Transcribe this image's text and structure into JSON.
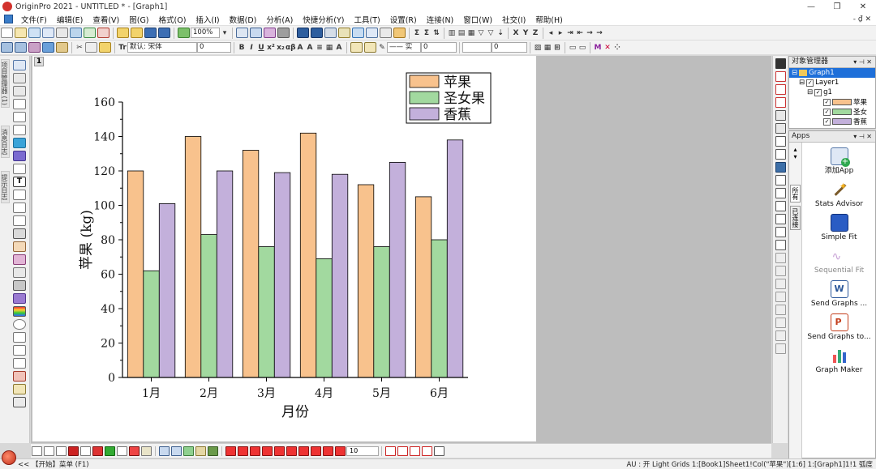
{
  "window": {
    "title": "OriginPro 2021 - UNTITLED * - [Graph1]",
    "controls": {
      "minimize": "—",
      "restore": "❐",
      "close": "✕"
    },
    "mdi_controls": "- ₫ ✕"
  },
  "menu": [
    "文件(F)",
    "编辑(E)",
    "查看(V)",
    "图(G)",
    "格式(O)",
    "插入(I)",
    "数据(D)",
    "分析(A)",
    "快捷分析(Y)",
    "工具(T)",
    "设置(R)",
    "连接(N)",
    "窗口(W)",
    "社交(I)",
    "帮助(H)"
  ],
  "toolbar": {
    "zoom": "100%",
    "font_name": "默认: 宋体",
    "font_size": "0",
    "bottom_size": "10",
    "line_width": "0"
  },
  "layer_number": "1",
  "left_tabs": [
    "项目管理器 (1)",
    "消息日志",
    "提示日志"
  ],
  "object_manager": {
    "title": "对象管理器",
    "graph": "Graph1",
    "layer": "Layer1",
    "group": "g1",
    "plots": [
      {
        "label": "苹果",
        "color": "#F8C28D"
      },
      {
        "label": "圣女",
        "color": "#A2D99F"
      },
      {
        "label": "香蕉",
        "color": "#C3B0DB"
      }
    ]
  },
  "apps_panel": {
    "title": "Apps",
    "nav_tabs": [
      "所有",
      "已连接"
    ],
    "items": [
      {
        "label": "添加App",
        "enabled": true
      },
      {
        "label": "Stats Advisor",
        "enabled": true
      },
      {
        "label": "Simple Fit",
        "enabled": true
      },
      {
        "label": "Sequential Fit",
        "enabled": false
      },
      {
        "label": "Send Graphs ...",
        "enabled": true
      },
      {
        "label": "Send Graphs to...",
        "enabled": true
      },
      {
        "label": "Graph Maker",
        "enabled": true
      }
    ]
  },
  "statusbar": {
    "left": "<< 【开始】菜单 (F1)",
    "right": "AU : 开  Light Grids  1:[Book1]Sheet1!Col(\"苹果\")[1:6]  1:[Graph1]1!1  弧度"
  },
  "chart_data": {
    "type": "bar",
    "categories": [
      "1月",
      "2月",
      "3月",
      "4月",
      "5月",
      "6月"
    ],
    "series": [
      {
        "name": "苹果",
        "values": [
          120,
          140,
          132,
          142,
          112,
          105
        ],
        "color": "#F8C28D"
      },
      {
        "name": "圣女果",
        "values": [
          62,
          83,
          76,
          69,
          76,
          80
        ],
        "color": "#A2D99F"
      },
      {
        "name": "香蕉",
        "values": [
          101,
          120,
          119,
          118,
          125,
          138
        ],
        "color": "#C3B0DB"
      }
    ],
    "title": "",
    "xlabel": "月份",
    "ylabel": "苹果  (kg)",
    "ylim": [
      0,
      160
    ],
    "yticks": [
      0,
      20,
      40,
      60,
      80,
      100,
      120,
      140,
      160
    ],
    "grid": false,
    "legend": "top-right"
  }
}
